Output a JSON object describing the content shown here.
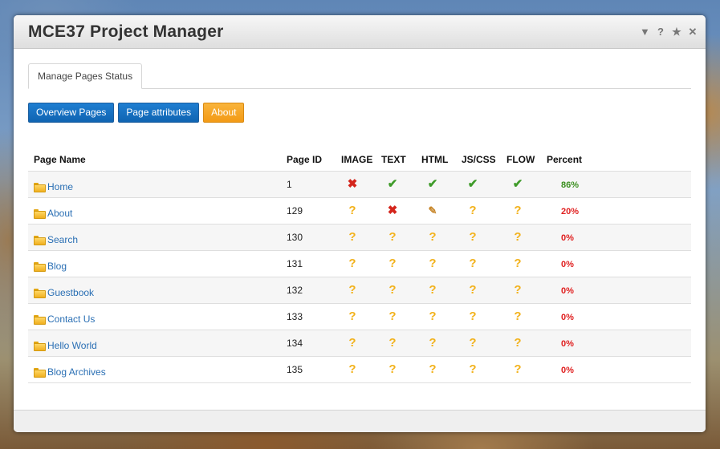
{
  "window": {
    "title": "MCE37 Project Manager"
  },
  "title_icons": [
    "▼",
    "?",
    "★",
    "✕"
  ],
  "tabs": [
    "Manage Pages Status"
  ],
  "buttons": {
    "overview": "Overview Pages",
    "attributes": "Page attributes",
    "about": "About"
  },
  "table": {
    "headers": {
      "name": "Page Name",
      "id": "Page ID",
      "image": "IMAGE",
      "text": "TEXT",
      "html": "HTML",
      "jscss": "JS/CSS",
      "flow": "FLOW",
      "percent": "Percent"
    },
    "rows": [
      {
        "name": "Home",
        "id": "1",
        "status": [
          "fail",
          "done",
          "done",
          "done",
          "done"
        ],
        "percent": "86%",
        "percent_color": "#3a8f1f"
      },
      {
        "name": "About",
        "id": "129",
        "status": [
          "unknown",
          "fail",
          "edit",
          "unknown",
          "unknown"
        ],
        "percent": "20%",
        "percent_color": "#e02020"
      },
      {
        "name": "Search",
        "id": "130",
        "status": [
          "unknown",
          "unknown",
          "unknown",
          "unknown",
          "unknown"
        ],
        "percent": "0%",
        "percent_color": "#e02020"
      },
      {
        "name": "Blog",
        "id": "131",
        "status": [
          "unknown",
          "unknown",
          "unknown",
          "unknown",
          "unknown"
        ],
        "percent": "0%",
        "percent_color": "#e02020"
      },
      {
        "name": "Guestbook",
        "id": "132",
        "status": [
          "unknown",
          "unknown",
          "unknown",
          "unknown",
          "unknown"
        ],
        "percent": "0%",
        "percent_color": "#e02020"
      },
      {
        "name": "Contact Us",
        "id": "133",
        "status": [
          "unknown",
          "unknown",
          "unknown",
          "unknown",
          "unknown"
        ],
        "percent": "0%",
        "percent_color": "#e02020"
      },
      {
        "name": "Hello World",
        "id": "134",
        "status": [
          "unknown",
          "unknown",
          "unknown",
          "unknown",
          "unknown"
        ],
        "percent": "0%",
        "percent_color": "#e02020"
      },
      {
        "name": "Blog Archives",
        "id": "135",
        "status": [
          "unknown",
          "unknown",
          "unknown",
          "unknown",
          "unknown"
        ],
        "percent": "0%",
        "percent_color": "#e02020"
      }
    ]
  },
  "colors": {
    "button_blue": "#0f64b2",
    "button_orange": "#f39a15",
    "link": "#2a6fb4"
  }
}
